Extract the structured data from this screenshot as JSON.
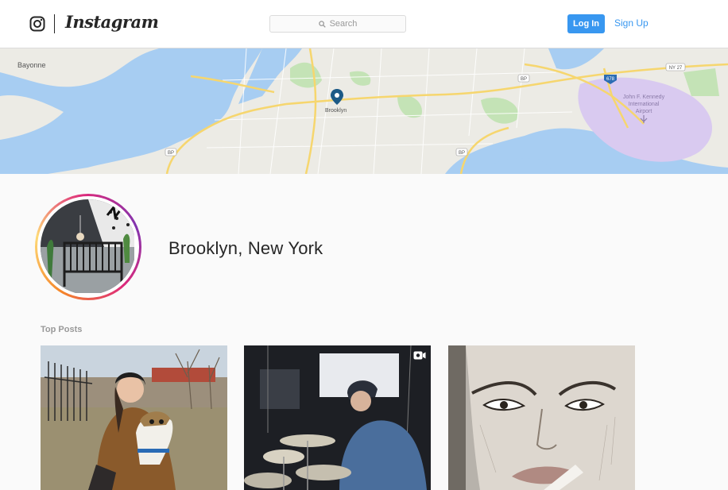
{
  "header": {
    "brand_name": "Instagram",
    "logo_icon": "instagram-camera-icon",
    "search": {
      "placeholder": "Search",
      "icon": "search-icon"
    },
    "login_label": "Log In",
    "signup_label": "Sign Up"
  },
  "map": {
    "labels": {
      "bayonne": "Bayonne",
      "brooklyn": "Brooklyn",
      "airport_line1": "John F. Kennedy",
      "airport_line2": "International",
      "airport_line3": "Airport",
      "bp1": "BP",
      "bp2": "BP",
      "bp3": "BP",
      "i678": "678",
      "ny27": "NY 27"
    },
    "pin_icon": "location-pin-icon",
    "colors": {
      "water": "#a7cdf2",
      "land": "#ecebe5",
      "highway": "#f6d66e",
      "park": "#c4e3b6",
      "airport": "#d9caf0",
      "pin": "#1c5a86"
    }
  },
  "profile": {
    "location_name": "Brooklyn, New York",
    "avatar_alt": "nursery-photo"
  },
  "top_posts": {
    "label": "Top Posts",
    "posts": [
      {
        "kind": "image",
        "subject": "woman-with-dog"
      },
      {
        "kind": "video",
        "subject": "drummer",
        "badge_icon": "video-icon"
      },
      {
        "kind": "image",
        "subject": "face-sketch"
      }
    ]
  },
  "colors": {
    "accent": "#3897f0",
    "text": "#262626",
    "muted": "#999999"
  }
}
